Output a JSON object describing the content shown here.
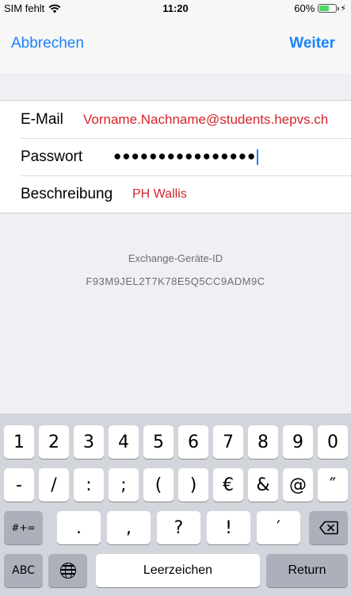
{
  "status_bar": {
    "carrier": "SIM fehlt",
    "time": "11:20",
    "battery": "60%",
    "battery_level": 0.6
  },
  "nav": {
    "cancel": "Abbrechen",
    "next": "Weiter"
  },
  "form": {
    "email": {
      "label": "E-Mail",
      "value": "Vorname.Nachname@students.hepvs.ch"
    },
    "password": {
      "label": "Passwort",
      "value": "●●●●●●●●●●●●●●●●"
    },
    "description": {
      "label": "Beschreibung",
      "value": "PH Wallis"
    }
  },
  "device": {
    "label": "Exchange-Geräte-ID",
    "id": "F93M9JEL2T7K78E5Q5CC9ADM9C"
  },
  "keyboard": {
    "row1": [
      "1",
      "2",
      "3",
      "4",
      "5",
      "6",
      "7",
      "8",
      "9",
      "0"
    ],
    "row2": [
      "-",
      "/",
      ":",
      ";",
      "(",
      ")",
      "€",
      "&",
      "@",
      "″"
    ],
    "symbols_toggle": "#+=",
    "row3": [
      ".",
      ",",
      "?",
      "!",
      "′"
    ],
    "abc": "ABC",
    "space": "Leerzeichen",
    "return": "Return"
  },
  "icons": {
    "wifi": "wifi-icon",
    "bolt": "charging-bolt-icon",
    "globe": "globe-icon",
    "backspace": "backspace-icon"
  }
}
